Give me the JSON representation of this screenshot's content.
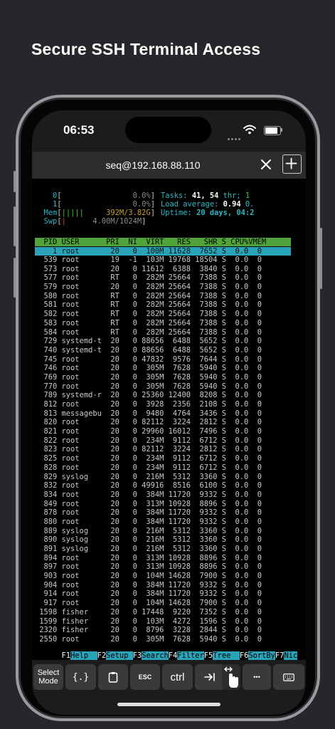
{
  "headline": "Secure SSH Terminal Access",
  "status": {
    "time": "06:53"
  },
  "tab": {
    "title": "seq@192.168.88.110"
  },
  "meters": [
    {
      "label": "0",
      "bar": "",
      "value": "0.0%"
    },
    {
      "label": "1",
      "bar": "",
      "value": "0.0%"
    },
    {
      "label": "Mem",
      "bar": "|||||",
      "value": "392M/3.82G"
    },
    {
      "label": "Swp",
      "bar": "|",
      "value": "4.00M/1024M"
    }
  ],
  "summary": {
    "tasks_label": "Tasks:",
    "tasks": "41, 54",
    "thr_label": " thr;",
    "running": "1",
    "load_label": "Load average:",
    "load1": "0.94",
    "load5": "0.",
    "uptime_label": "Uptime:",
    "uptime": "20 days, 04:2"
  },
  "table": {
    "header": "  PID USER      PRI  NI  VIRT   RES   SHR S CPU%VMEM",
    "selected": "    1 root       20   0  100M 11628  7652 S  0.0  0",
    "rows": [
      "  539 root       19  -1  103M 19768 18504 S  0.0  0",
      "  573 root       20   0 11612  6388  3840 S  0.0  0",
      "  577 root       RT   0  282M 25664  7388 S  0.0  0",
      "  579 root       20   0  282M 25664  7388 S  0.0  0",
      "  580 root       RT   0  282M 25664  7388 S  0.0  0",
      "  581 root       RT   0  282M 25664  7388 S  0.0  0",
      "  582 root       RT   0  282M 25664  7388 S  0.0  0",
      "  583 root       RT   0  282M 25664  7388 S  0.0  0",
      "  584 root       RT   0  282M 25664  7388 S  0.0  0",
      "  729 systemd-t  20   0 88656  6488  5652 S  0.0  0",
      "  740 systemd-t  20   0 88656  6488  5652 S  0.0  0",
      "  745 root       20   0 47832  9576  7644 S  0.0  0",
      "  746 root       20   0  305M  7628  5940 S  0.0  0",
      "  769 root       20   0  305M  7628  5940 S  0.0  0",
      "  770 root       20   0  305M  7628  5940 S  0.0  0",
      "  789 systemd-r  20   0 25360 12400  8208 S  0.0  0",
      "  812 root       20   0  3928  2356  2108 S  0.0  0",
      "  813 messagebu  20   0  9480  4764  3436 S  0.0  0",
      "  820 root       20   0 82112  3224  2812 S  0.0  0",
      "  821 root       20   0 29960 16012  7496 S  0.0  0",
      "  822 root       20   0  234M  9112  6712 S  0.0  0",
      "  823 root       20   0 82112  3224  2812 S  0.0  0",
      "  825 root       20   0  234M  9112  6712 S  0.0  0",
      "  828 root       20   0  234M  9112  6712 S  0.0  0",
      "  829 syslog     20   0  216M  5312  3360 S  0.0  0",
      "  832 root       20   0 49916  8516  6100 S  0.0  0",
      "  834 root       20   0  384M 11720  9332 S  0.0  0",
      "  849 root       20   0  313M 10928  8896 S  0.0  0",
      "  878 root       20   0  384M 11720  9332 S  0.0  0",
      "  880 root       20   0  384M 11720  9332 S  0.0  0",
      "  889 syslog     20   0  216M  5312  3360 S  0.0  0",
      "  890 syslog     20   0  216M  5312  3360 S  0.0  0",
      "  891 syslog     20   0  216M  5312  3360 S  0.0  0",
      "  894 root       20   0  313M 10928  8896 S  0.0  0",
      "  897 root       20   0  313M 10928  8896 S  0.0  0",
      "  903 root       20   0  104M 14628  7900 S  0.0  0",
      "  904 root       20   0  384M 11720  9332 S  0.0  0",
      "  914 root       20   0  384M 11720  9332 S  0.0  0",
      "  917 root       20   0  104M 14628  7900 S  0.0  0",
      " 1598 fisher     20   0 17448  9220  7352 S  0.0  0",
      " 1599 fisher     20   0  103M  4272  1596 S  0.0  0",
      " 2320 fisher     20   0  8796  3228  2844 S  0.0  0",
      " 2550 root       20   0  305M  7628  5940 S  0.0  0"
    ]
  },
  "fkeys": [
    {
      "key": "F1",
      "label": "Help  "
    },
    {
      "key": "F2",
      "label": "Setup "
    },
    {
      "key": "F3",
      "label": "Search"
    },
    {
      "key": "F4",
      "label": "Filter"
    },
    {
      "key": "F5",
      "label": "Tree  "
    },
    {
      "key": "F6",
      "label": "SortBy"
    },
    {
      "key": "F7",
      "label": "Nic"
    }
  ],
  "toolbar": {
    "select_mode": "Select Mode",
    "braces": "{.}",
    "esc": "ESC",
    "ctrl": "ctrl",
    "more": "•••"
  },
  "icons": [
    "wifi-icon",
    "battery-icon",
    "close-icon",
    "plus-icon",
    "clipboard-icon",
    "tab-arrow-icon",
    "touch-drag-icon",
    "keyboard-icon"
  ]
}
